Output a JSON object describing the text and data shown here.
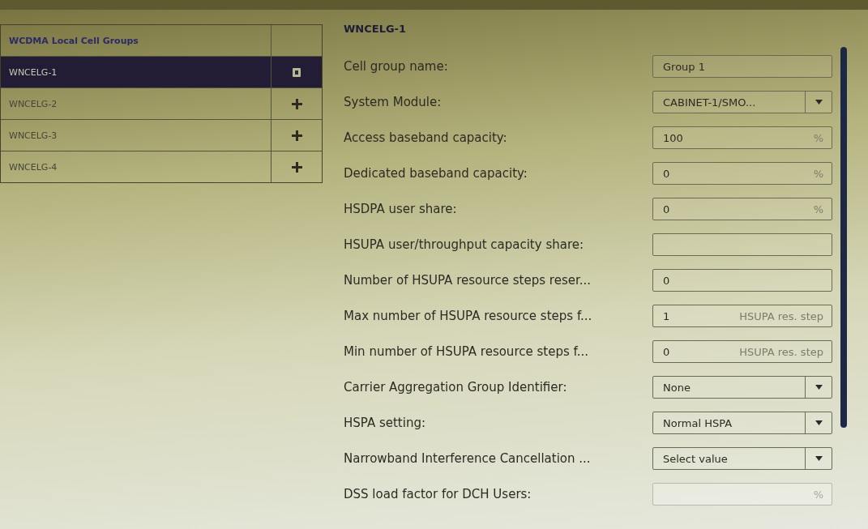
{
  "cell_groups": {
    "title": "WCDMA Local Cell Groups",
    "items": [
      {
        "label": "WNCELG-1",
        "selected": true,
        "kind": "delete"
      },
      {
        "label": "WNCELG-2",
        "selected": false,
        "kind": "add"
      },
      {
        "label": "WNCELG-3",
        "selected": false,
        "kind": "add"
      },
      {
        "label": "WNCELG-4",
        "selected": false,
        "kind": "add"
      }
    ]
  },
  "details": {
    "title": "WNCELG-1",
    "fields": [
      {
        "label": "Cell group name:",
        "kind": "text",
        "value": "Group 1",
        "disabled": false
      },
      {
        "label": "System Module:",
        "kind": "select",
        "value": "CABINET-1/SMO...",
        "disabled": false
      },
      {
        "label": "Access baseband capacity:",
        "kind": "text",
        "value": "100",
        "unit": "%",
        "disabled": false
      },
      {
        "label": "Dedicated baseband capacity:",
        "kind": "text",
        "value": "0",
        "unit": "%",
        "disabled": false
      },
      {
        "label": "HSDPA user share:",
        "kind": "text",
        "value": "0",
        "unit": "%",
        "disabled": false
      },
      {
        "label": "HSUPA user/throughput capacity share:",
        "kind": "text",
        "disabled": false
      },
      {
        "label": "Number of HSUPA resource steps reser...",
        "kind": "text",
        "value": "0",
        "disabled": false
      },
      {
        "label": "Max number of HSUPA resource steps f...",
        "kind": "text",
        "value": "1",
        "unit": "HSUPA res. step",
        "disabled": false
      },
      {
        "label": "Min number of HSUPA resource steps f...",
        "kind": "text",
        "value": "0",
        "unit": "HSUPA res. step",
        "disabled": false
      },
      {
        "label": "Carrier Aggregation Group Identifier:",
        "kind": "select",
        "value": "None",
        "disabled": false
      },
      {
        "label": "HSPA setting:",
        "kind": "select",
        "value": "Normal HSPA",
        "disabled": false
      },
      {
        "label": "Narrowband Interference Cancellation ...",
        "kind": "select",
        "value": "Select value",
        "disabled": false
      },
      {
        "label": "DSS load factor for DCH Users:",
        "kind": "text",
        "unit": "%",
        "disabled": true
      }
    ]
  }
}
